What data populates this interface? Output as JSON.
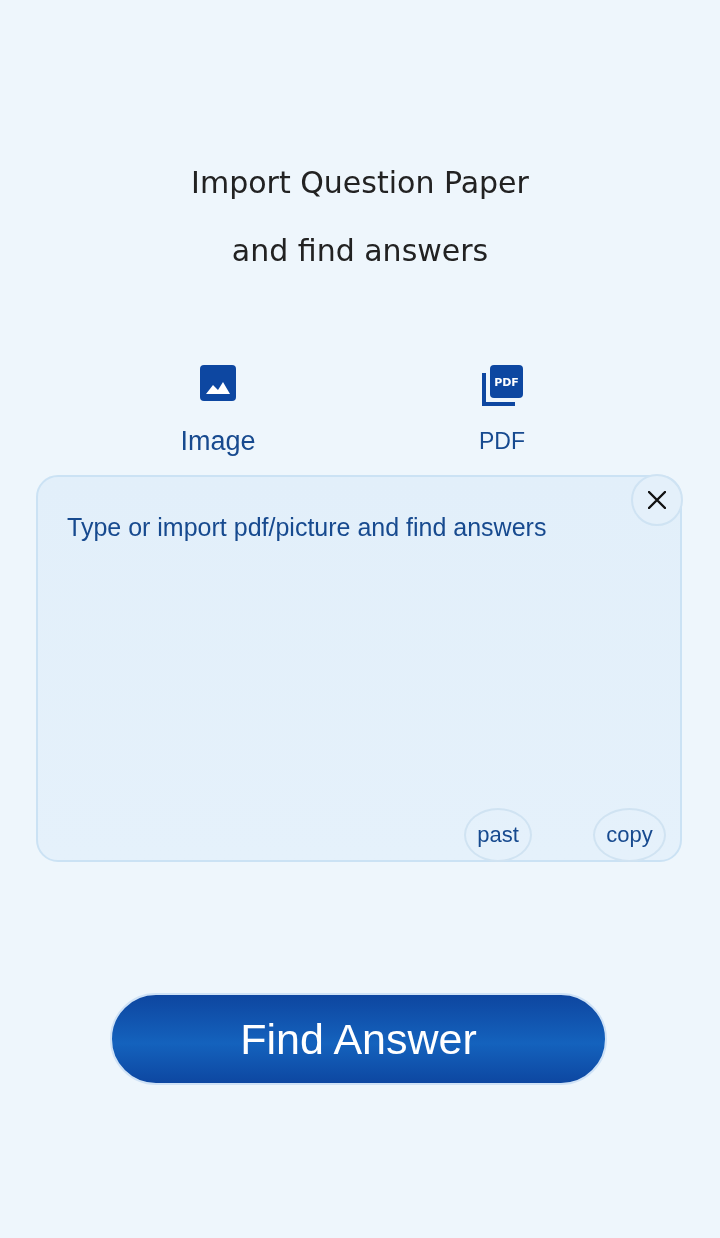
{
  "header": {
    "title_lines": [
      "Import Question Paper",
      "and find answers"
    ]
  },
  "import_options": [
    {
      "kind": "image",
      "label": "Image",
      "selected": true
    },
    {
      "kind": "pdf",
      "label": "PDF",
      "icon_text": "PDF",
      "selected": false
    }
  ],
  "question_field": {
    "placeholder": "Type or import pdf/picture and find answers"
  },
  "field_actions": [
    {
      "label": "past"
    },
    {
      "label": "copy"
    }
  ],
  "submit_button": {
    "label": "Find Answer"
  }
}
